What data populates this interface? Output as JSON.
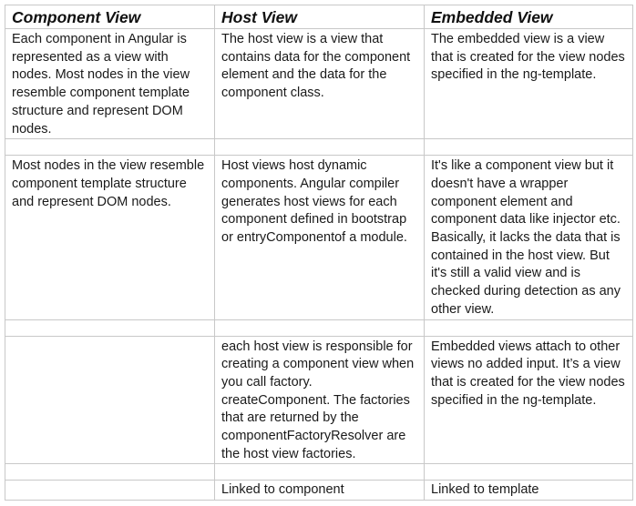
{
  "table": {
    "headers": [
      "Component View",
      "Host View",
      "Embedded View"
    ],
    "rows": [
      {
        "component_view": "Each component in Angular is represented as a view with nodes. Most nodes in the view resemble component template structure and represent DOM nodes.",
        "host_view": "The host view is a view that contains data for the component element and the data for the component class.",
        "embedded_view": "The embedded view is a view that is created for the view nodes specified in the ng-template."
      },
      {
        "component_view": "Most nodes in the view resemble component template structure and represent DOM nodes.",
        "host_view": "Host views host dynamic components. Angular compiler generates host views for each component defined in bootstrap or entryComponentof a module.",
        "embedded_view": "It's like a component view but it doesn't have a wrapper component element and component data like injector etc. Basically, it lacks the data that is contained in the host view. But it's still a valid view and is checked during detection as any other view."
      },
      {
        "component_view": "",
        "host_view": "each host view is responsible for creating a component view when you call factory. createComponent. The factories that are returned by the componentFactoryResolver are the host view factories.",
        "embedded_view": "Embedded views attach to other views no added input. It’s a view that is created for the view nodes specified in the ng-template."
      },
      {
        "component_view": "",
        "host_view": "Linked to component",
        "embedded_view": "Linked to template"
      }
    ]
  }
}
